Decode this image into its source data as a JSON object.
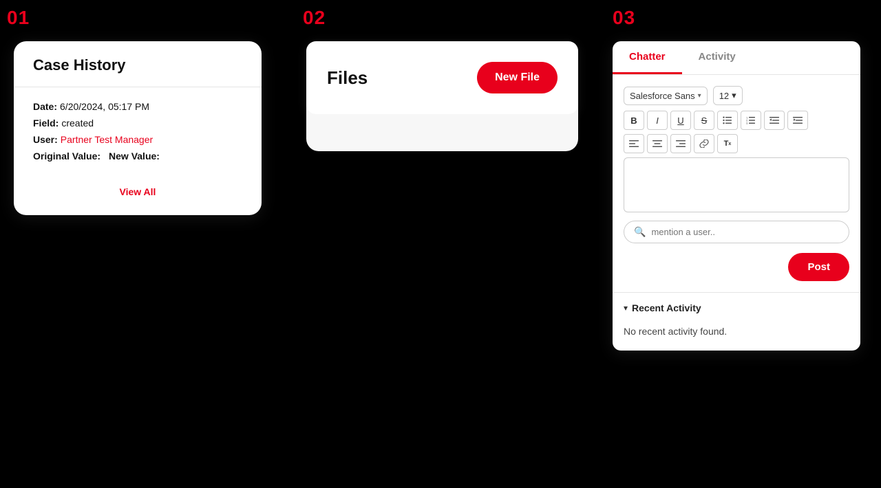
{
  "section01": {
    "number": "01",
    "card": {
      "title": "Case History",
      "rows": [
        {
          "label": "Date:",
          "value": "6/20/2024, 05:17 PM",
          "valueType": "normal"
        },
        {
          "label": "Field:",
          "value": "created",
          "valueType": "normal"
        },
        {
          "label": "User:",
          "value": "Partner Test Manager",
          "valueType": "red"
        },
        {
          "label": "Original Value:",
          "value": "",
          "valueType": "normal"
        },
        {
          "label": "New Value:",
          "value": "",
          "valueType": "normal"
        }
      ],
      "viewAll": "View All"
    }
  },
  "section02": {
    "number": "02",
    "card": {
      "filesLabel": "Files",
      "newFileButton": "New File"
    }
  },
  "section03": {
    "number": "03",
    "tabs": [
      {
        "label": "Chatter",
        "active": true
      },
      {
        "label": "Activity",
        "active": false
      }
    ],
    "toolbar": {
      "fontFamily": "Salesforce Sans",
      "fontSize": "12",
      "boldLabel": "B",
      "italicLabel": "I",
      "underlineLabel": "U",
      "strikeLabel": "S",
      "listBullet": "≡",
      "listOrdered": "≣",
      "indentLeft": "⇤",
      "indentRight": "⇥",
      "alignLeft": "≡",
      "alignCenter": "≡",
      "alignRight": "≡",
      "linkLabel": "🔗",
      "clearFormat": "Tx"
    },
    "mentionPlaceholder": "mention a user..",
    "postButton": "Post",
    "recentActivityLabel": "Recent Activity",
    "noActivityText": "No recent activity found."
  }
}
